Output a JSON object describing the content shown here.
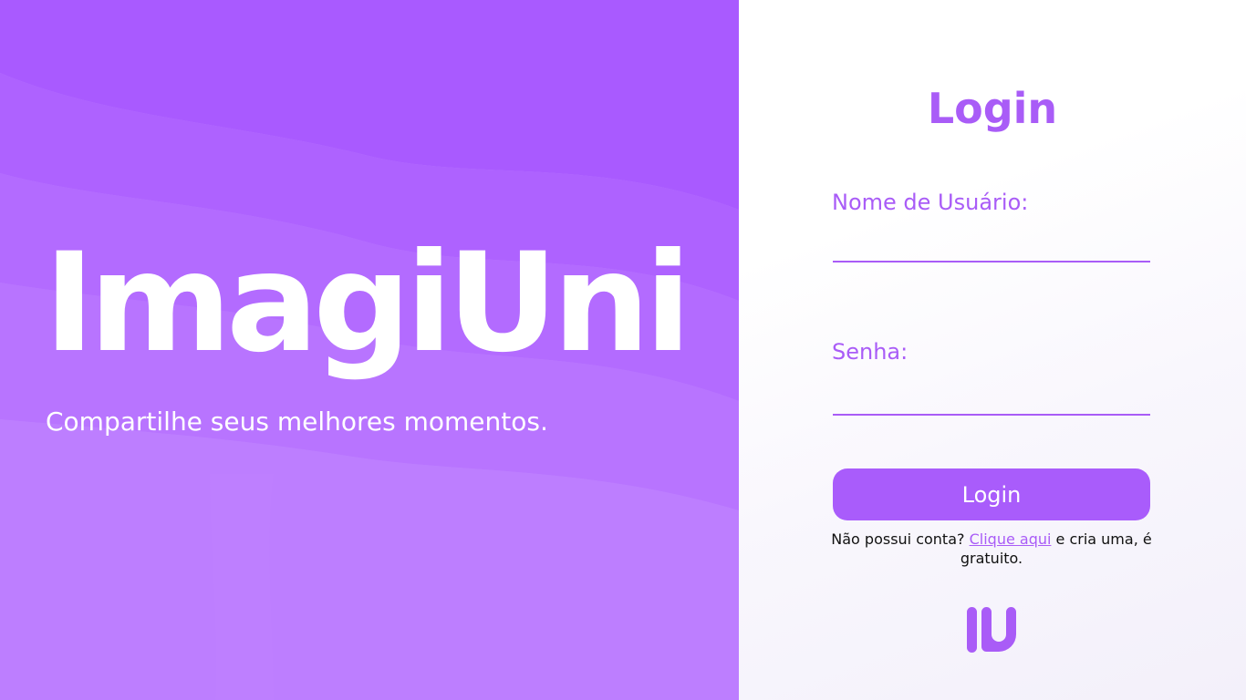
{
  "hero": {
    "brand": "ImagiUni",
    "tagline": "Compartilhe seus melhores momentos."
  },
  "login": {
    "title": "Login",
    "username_label": "Nome de Usuário:",
    "username_value": "",
    "password_label": "Senha:",
    "password_value": "",
    "button_label": "Login",
    "signup_prefix": "Não possui conta? ",
    "signup_link": "Clique aqui",
    "signup_suffix": " e cria uma, é gratuito."
  },
  "logo": {
    "icon": "iu-logo-icon"
  },
  "colors": {
    "accent": "#a95cf7",
    "hero_background": "#b07bff",
    "button": "#a95cfb"
  }
}
